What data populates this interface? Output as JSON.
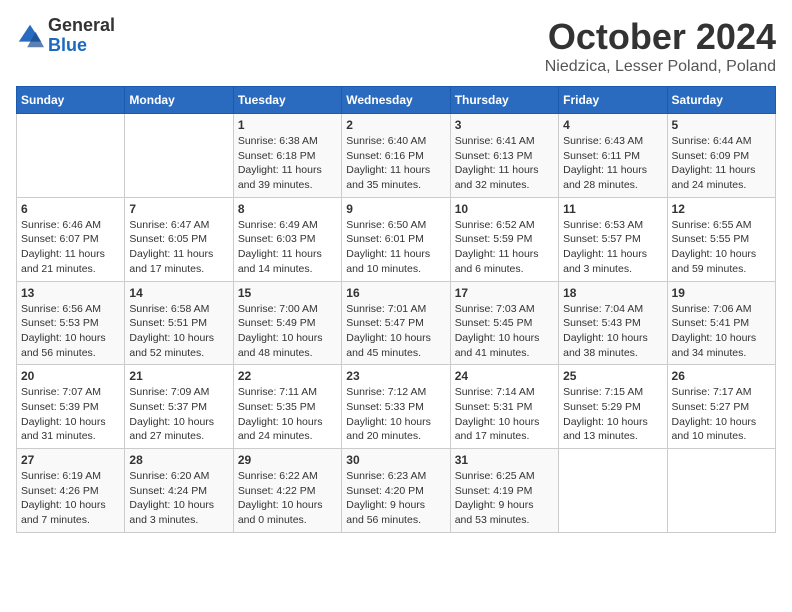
{
  "header": {
    "logo": {
      "general": "General",
      "blue": "Blue"
    },
    "title": "October 2024",
    "location": "Niedzica, Lesser Poland, Poland"
  },
  "calendar": {
    "days_of_week": [
      "Sunday",
      "Monday",
      "Tuesday",
      "Wednesday",
      "Thursday",
      "Friday",
      "Saturday"
    ],
    "weeks": [
      [
        {
          "day": "",
          "info": ""
        },
        {
          "day": "",
          "info": ""
        },
        {
          "day": "1",
          "info": "Sunrise: 6:38 AM\nSunset: 6:18 PM\nDaylight: 11 hours\nand 39 minutes."
        },
        {
          "day": "2",
          "info": "Sunrise: 6:40 AM\nSunset: 6:16 PM\nDaylight: 11 hours\nand 35 minutes."
        },
        {
          "day": "3",
          "info": "Sunrise: 6:41 AM\nSunset: 6:13 PM\nDaylight: 11 hours\nand 32 minutes."
        },
        {
          "day": "4",
          "info": "Sunrise: 6:43 AM\nSunset: 6:11 PM\nDaylight: 11 hours\nand 28 minutes."
        },
        {
          "day": "5",
          "info": "Sunrise: 6:44 AM\nSunset: 6:09 PM\nDaylight: 11 hours\nand 24 minutes."
        }
      ],
      [
        {
          "day": "6",
          "info": "Sunrise: 6:46 AM\nSunset: 6:07 PM\nDaylight: 11 hours\nand 21 minutes."
        },
        {
          "day": "7",
          "info": "Sunrise: 6:47 AM\nSunset: 6:05 PM\nDaylight: 11 hours\nand 17 minutes."
        },
        {
          "day": "8",
          "info": "Sunrise: 6:49 AM\nSunset: 6:03 PM\nDaylight: 11 hours\nand 14 minutes."
        },
        {
          "day": "9",
          "info": "Sunrise: 6:50 AM\nSunset: 6:01 PM\nDaylight: 11 hours\nand 10 minutes."
        },
        {
          "day": "10",
          "info": "Sunrise: 6:52 AM\nSunset: 5:59 PM\nDaylight: 11 hours\nand 6 minutes."
        },
        {
          "day": "11",
          "info": "Sunrise: 6:53 AM\nSunset: 5:57 PM\nDaylight: 11 hours\nand 3 minutes."
        },
        {
          "day": "12",
          "info": "Sunrise: 6:55 AM\nSunset: 5:55 PM\nDaylight: 10 hours\nand 59 minutes."
        }
      ],
      [
        {
          "day": "13",
          "info": "Sunrise: 6:56 AM\nSunset: 5:53 PM\nDaylight: 10 hours\nand 56 minutes."
        },
        {
          "day": "14",
          "info": "Sunrise: 6:58 AM\nSunset: 5:51 PM\nDaylight: 10 hours\nand 52 minutes."
        },
        {
          "day": "15",
          "info": "Sunrise: 7:00 AM\nSunset: 5:49 PM\nDaylight: 10 hours\nand 48 minutes."
        },
        {
          "day": "16",
          "info": "Sunrise: 7:01 AM\nSunset: 5:47 PM\nDaylight: 10 hours\nand 45 minutes."
        },
        {
          "day": "17",
          "info": "Sunrise: 7:03 AM\nSunset: 5:45 PM\nDaylight: 10 hours\nand 41 minutes."
        },
        {
          "day": "18",
          "info": "Sunrise: 7:04 AM\nSunset: 5:43 PM\nDaylight: 10 hours\nand 38 minutes."
        },
        {
          "day": "19",
          "info": "Sunrise: 7:06 AM\nSunset: 5:41 PM\nDaylight: 10 hours\nand 34 minutes."
        }
      ],
      [
        {
          "day": "20",
          "info": "Sunrise: 7:07 AM\nSunset: 5:39 PM\nDaylight: 10 hours\nand 31 minutes."
        },
        {
          "day": "21",
          "info": "Sunrise: 7:09 AM\nSunset: 5:37 PM\nDaylight: 10 hours\nand 27 minutes."
        },
        {
          "day": "22",
          "info": "Sunrise: 7:11 AM\nSunset: 5:35 PM\nDaylight: 10 hours\nand 24 minutes."
        },
        {
          "day": "23",
          "info": "Sunrise: 7:12 AM\nSunset: 5:33 PM\nDaylight: 10 hours\nand 20 minutes."
        },
        {
          "day": "24",
          "info": "Sunrise: 7:14 AM\nSunset: 5:31 PM\nDaylight: 10 hours\nand 17 minutes."
        },
        {
          "day": "25",
          "info": "Sunrise: 7:15 AM\nSunset: 5:29 PM\nDaylight: 10 hours\nand 13 minutes."
        },
        {
          "day": "26",
          "info": "Sunrise: 7:17 AM\nSunset: 5:27 PM\nDaylight: 10 hours\nand 10 minutes."
        }
      ],
      [
        {
          "day": "27",
          "info": "Sunrise: 6:19 AM\nSunset: 4:26 PM\nDaylight: 10 hours\nand 7 minutes."
        },
        {
          "day": "28",
          "info": "Sunrise: 6:20 AM\nSunset: 4:24 PM\nDaylight: 10 hours\nand 3 minutes."
        },
        {
          "day": "29",
          "info": "Sunrise: 6:22 AM\nSunset: 4:22 PM\nDaylight: 10 hours\nand 0 minutes."
        },
        {
          "day": "30",
          "info": "Sunrise: 6:23 AM\nSunset: 4:20 PM\nDaylight: 9 hours\nand 56 minutes."
        },
        {
          "day": "31",
          "info": "Sunrise: 6:25 AM\nSunset: 4:19 PM\nDaylight: 9 hours\nand 53 minutes."
        },
        {
          "day": "",
          "info": ""
        },
        {
          "day": "",
          "info": ""
        }
      ]
    ]
  }
}
